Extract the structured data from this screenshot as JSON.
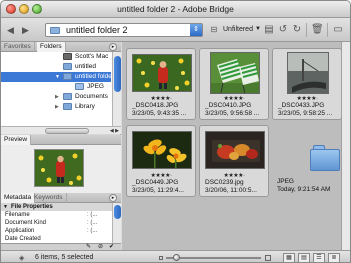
{
  "window": {
    "title": "untitled folder 2 - Adobe Bridge"
  },
  "toolbar": {
    "back_icon": "left-arrow-icon",
    "forward_icon": "right-arrow-icon",
    "location": "untitled folder 2",
    "filter": "Unfiltered"
  },
  "folders_panel": {
    "tabs": [
      "Favorites",
      "Folders"
    ],
    "active_tab": "Folders",
    "items": [
      {
        "label": "Scott's Mac",
        "indent": 4
      },
      {
        "label": "untitled",
        "indent": 4
      },
      {
        "label": "untitled folder 2",
        "indent": 3,
        "selected": true
      },
      {
        "label": "JPEG",
        "indent": 4
      },
      {
        "label": "Documents",
        "indent": 3
      },
      {
        "label": "Library",
        "indent": 3
      }
    ]
  },
  "preview_panel": {
    "tab": "Preview"
  },
  "metadata_panel": {
    "tabs": [
      "Metadata",
      "Keywords"
    ],
    "section": "File Properties",
    "rows": [
      {
        "label": "Filename",
        "value": ": (..."
      },
      {
        "label": "Document Kind",
        "value": ": (..."
      },
      {
        "label": "Application",
        "value": ": (..."
      },
      {
        "label": "Date Created",
        "value": ""
      }
    ]
  },
  "thumbnails": [
    {
      "name": "_DSC0418.JPG",
      "date": "3/23/05, 9:43:35 ...",
      "stars": "★★★★·",
      "selected": true
    },
    {
      "name": "_DSC0410.JPG",
      "date": "3/23/05, 9:56:58 ...",
      "stars": "★★★★·",
      "selected": true
    },
    {
      "name": "_DSC0433.JPG",
      "date": "3/23/05, 9:58:25 ...",
      "stars": "★★★★·",
      "selected": true
    },
    {
      "name": "_DSC0449.JPG",
      "date": "3/23/05, 11:29:4...",
      "stars": "★★★★·",
      "selected": true
    },
    {
      "name": "DSC0239.jpg",
      "date": "3/20/06, 11:00:5...",
      "stars": "★★★★·",
      "selected": true
    },
    {
      "name": "JPEG",
      "date": "Today, 9:21:54 AM",
      "stars": "",
      "selected": false
    }
  ],
  "status": {
    "text": "6 items, 5 selected"
  }
}
